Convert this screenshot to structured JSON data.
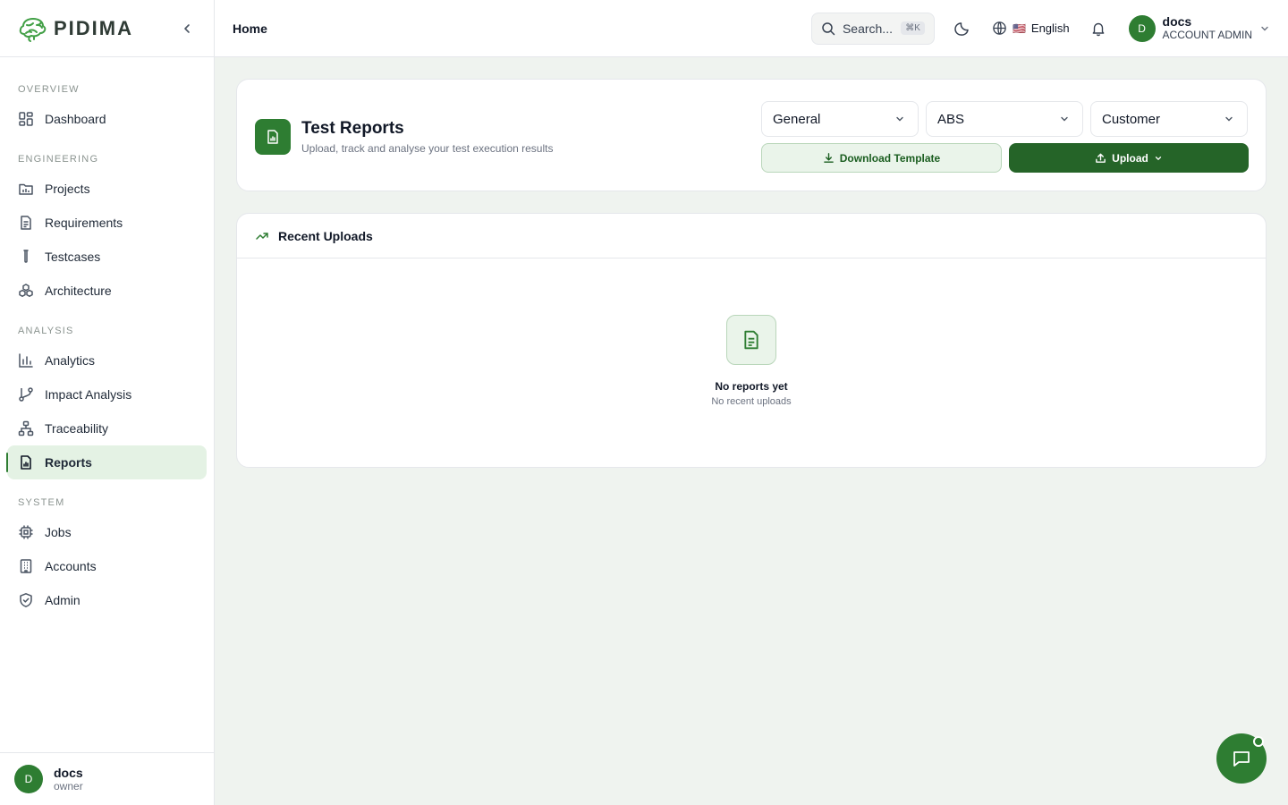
{
  "colors": {
    "accent": "#2e7d32",
    "accent_light": "#e4f2e4",
    "background": "#eff3ef"
  },
  "brand": {
    "name": "PIDIMA"
  },
  "sidebar": {
    "sections": {
      "overview": "OVERVIEW",
      "engineering": "ENGINEERING",
      "analysis": "ANALYSIS",
      "system": "SYSTEM"
    },
    "items": {
      "dashboard": "Dashboard",
      "projects": "Projects",
      "requirements": "Requirements",
      "testcases": "Testcases",
      "architecture": "Architecture",
      "analytics": "Analytics",
      "impact_analysis": "Impact Analysis",
      "traceability": "Traceability",
      "reports": "Reports",
      "jobs": "Jobs",
      "accounts": "Accounts",
      "admin": "Admin"
    },
    "active_item": "Reports",
    "user": {
      "initial": "D",
      "name": "docs",
      "role": "owner"
    }
  },
  "header": {
    "breadcrumb": "Home",
    "search": {
      "placeholder": "Search...",
      "shortcut": "⌘K"
    },
    "language": {
      "flag": "🇺🇸",
      "label": "English"
    },
    "account": {
      "initial": "D",
      "name": "docs",
      "role": "ACCOUNT ADMIN"
    }
  },
  "main": {
    "title": "Test Reports",
    "subtitle": "Upload, track and analyse your test execution results",
    "filters": {
      "type": "General",
      "project": "ABS",
      "scope": "Customer"
    },
    "buttons": {
      "download": "Download Template",
      "upload": "Upload"
    },
    "recent": {
      "title": "Recent Uploads",
      "empty_title": "No reports yet",
      "empty_subtitle": "No recent uploads"
    }
  }
}
